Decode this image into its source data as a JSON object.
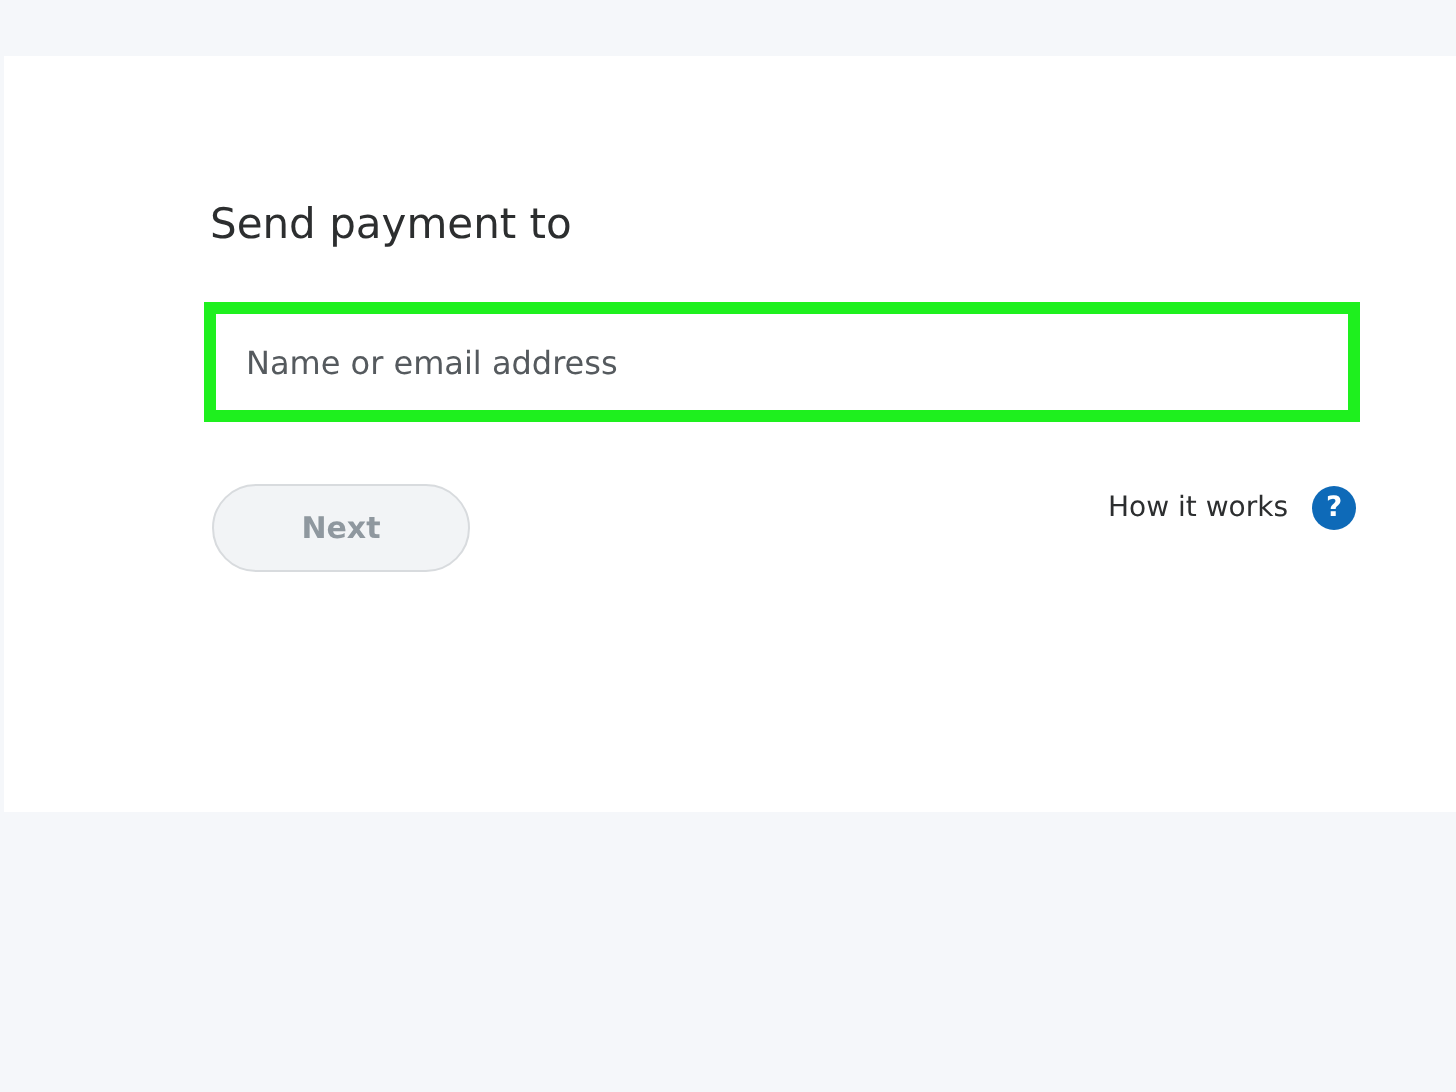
{
  "heading": "Send payment to",
  "recipient_field": {
    "placeholder": "Name or email address",
    "highlighted": true
  },
  "next_button": {
    "label": "Next",
    "disabled": true
  },
  "help_link": {
    "label": "How it works",
    "icon": "?"
  }
}
